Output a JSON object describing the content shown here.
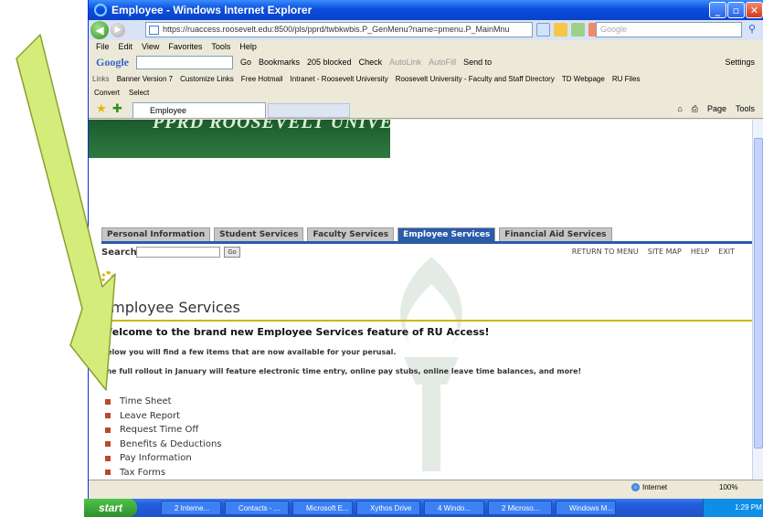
{
  "window": {
    "title": "Employee - Windows Internet Explorer",
    "address": "https://ruaccess.roosevelt.edu:8500/pls/pprd/twbkwbis.P_GenMenu?name=pmenu.P_MainMnu",
    "search_placeholder": "Google"
  },
  "menubar": [
    "File",
    "Edit",
    "View",
    "Favorites",
    "Tools",
    "Help"
  ],
  "googlebar": {
    "logo": "Google",
    "items": [
      "Go",
      "Bookmarks",
      "205 blocked",
      "Check",
      "AutoLink",
      "AutoFill",
      "Send to",
      "Settings"
    ]
  },
  "links": [
    "Links",
    "Banner Version 7",
    "Customize Links",
    "Free Hotmail",
    "Intranet - Roosevelt University",
    "Roosevelt University - Faculty and Staff Directory",
    "TD Webpage",
    "RU Files"
  ],
  "convertbar": [
    "Convert",
    "Select"
  ],
  "tab": {
    "label": "Employee",
    "tools": [
      "Page",
      "Tools"
    ]
  },
  "page": {
    "banner_text": "PPRD ROOSEVELT UNIVERSITY RU ACCESS",
    "nav_tabs": [
      "Personal Information",
      "Student Services",
      "Faculty Services",
      "Employee Services",
      "Financial Aid Services"
    ],
    "active_tab": "Employee Services",
    "search_label": "Search",
    "go_label": "Go",
    "top_links": [
      "RETURN TO MENU",
      "SITE MAP",
      "HELP",
      "EXIT"
    ],
    "title": "Employee Services",
    "welcome": "Welcome to the brand new Employee Services feature of RU Access!",
    "para1": "Below you will find a few items that are now available for your perusal.",
    "para2": "The full rollout in January will feature electronic time entry, online pay stubs, online leave time balances, and more!",
    "items": [
      "Time Sheet",
      "Leave Report",
      "Request Time Off",
      "Benefits & Deductions",
      "Pay Information",
      "Tax Forms"
    ]
  },
  "statusbar": {
    "zone": "Internet",
    "zoom": "100%"
  },
  "taskbar": {
    "start": "start",
    "tasks": [
      "2 Interne...",
      "Contacts - ...",
      "Microsoft E...",
      "Xythos Drive",
      "4 Windo...",
      "2 Microso...",
      "Windows M..."
    ],
    "clock": "1:29 PM"
  },
  "colors": {
    "arrow_fill": "#d4ec7a",
    "arrow_stroke": "#8aa030",
    "nav_active": "#2a5ca8",
    "title_rule": "#c9b800",
    "bullet": "#b84a2a"
  }
}
